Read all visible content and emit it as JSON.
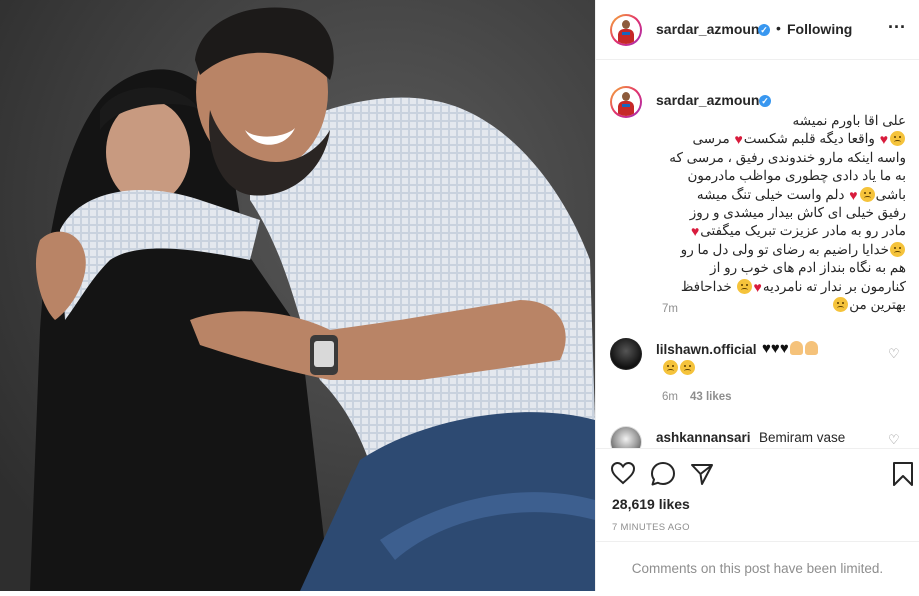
{
  "header": {
    "username": "sardar_azmoun",
    "separator": "•",
    "follow_status": "Following",
    "more_label": "..."
  },
  "caption": {
    "username": "sardar_azmoun",
    "lines": [
      "علی اقا باورم نمیشه",
      "واقعا دیگه قلبم شکست",
      "مرسی",
      "واسه اینکه مارو خندوندی رفیق ، مرسی که",
      "به ما یاد دادی چطوری مواظب مادرمون",
      "باشی",
      "دلم واست خیلی تنگ میشه",
      "رفیق خیلی ای کاش بیدار میشدی و روز",
      "مادر رو به مادر عزیزت تبریک میگفتی",
      "خدایا راضیم به رضای تو ولی دل ما رو",
      "هم به نگاه بنداز ادم های خوب رو از",
      "کنارمون بر ندار ته نامردیه",
      "خداحافظ",
      "بهترین من"
    ],
    "time": "7m"
  },
  "comments": [
    {
      "username": "lilshawn.official",
      "time": "6m",
      "likes": "43 likes"
    },
    {
      "username": "ashkannansari",
      "text": "Bemiram vase"
    }
  ],
  "actions": {
    "like_icon": "heart-outline-icon",
    "comment_icon": "speech-bubble-icon",
    "share_icon": "paper-plane-icon",
    "save_icon": "bookmark-icon"
  },
  "likes_count": "28,619 likes",
  "posted_ago": "7 MINUTES AGO",
  "comments_limited": "Comments on this post have been limited.",
  "colors": {
    "accent_blue": "#3897f0",
    "heart_red": "#d81b3c",
    "text_dark": "#262626",
    "text_grey": "#8e8e8e",
    "photo_bg": "#3c3c3c"
  }
}
